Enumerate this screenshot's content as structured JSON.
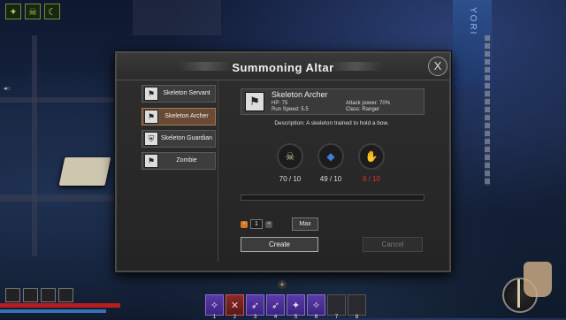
{
  "dialog": {
    "title": "Summoning Altar",
    "close_label": "X"
  },
  "list": [
    {
      "label": "Skeleton Servant",
      "selected": false
    },
    {
      "label": "Skeleton Archer",
      "selected": true
    },
    {
      "label": "Skeleton Guardian",
      "selected": false
    },
    {
      "label": "Zombie",
      "selected": false
    }
  ],
  "selected": {
    "name": "Skeleton Archer",
    "hp": "HP: 75",
    "run_speed": "Run Speed: 5.5",
    "attack_power": "Attack power: 70%",
    "class": "Class: Ranger",
    "description": "Description: A skeleton trained to hold a bow."
  },
  "requirements": [
    {
      "icon": "bone-material-icon",
      "count": "70 / 10",
      "enough": true
    },
    {
      "icon": "blue-gem-icon",
      "count": "49 / 10",
      "enough": true
    },
    {
      "icon": "flesh-material-icon",
      "count": "6 / 10",
      "enough": false
    }
  ],
  "progress": 0,
  "quantity": {
    "value": "1",
    "minus": "-",
    "plus": "+",
    "max_label": "Max"
  },
  "buttons": {
    "create": "Create",
    "cancel": "Cancel"
  },
  "hotbar": [
    {
      "num": "1",
      "style": "act"
    },
    {
      "num": "2",
      "style": "red"
    },
    {
      "num": "3",
      "style": "act"
    },
    {
      "num": "4",
      "style": "act"
    },
    {
      "num": "5",
      "style": "act"
    },
    {
      "num": "6",
      "style": "act"
    },
    {
      "num": "7",
      "style": ""
    },
    {
      "num": "8",
      "style": ""
    }
  ],
  "hud": {
    "plus": "+",
    "banner_text": "YORI"
  },
  "colors": {
    "accent_selected": "#6b4a35",
    "insufficient": "#e03030",
    "health": "#b81e1e"
  }
}
